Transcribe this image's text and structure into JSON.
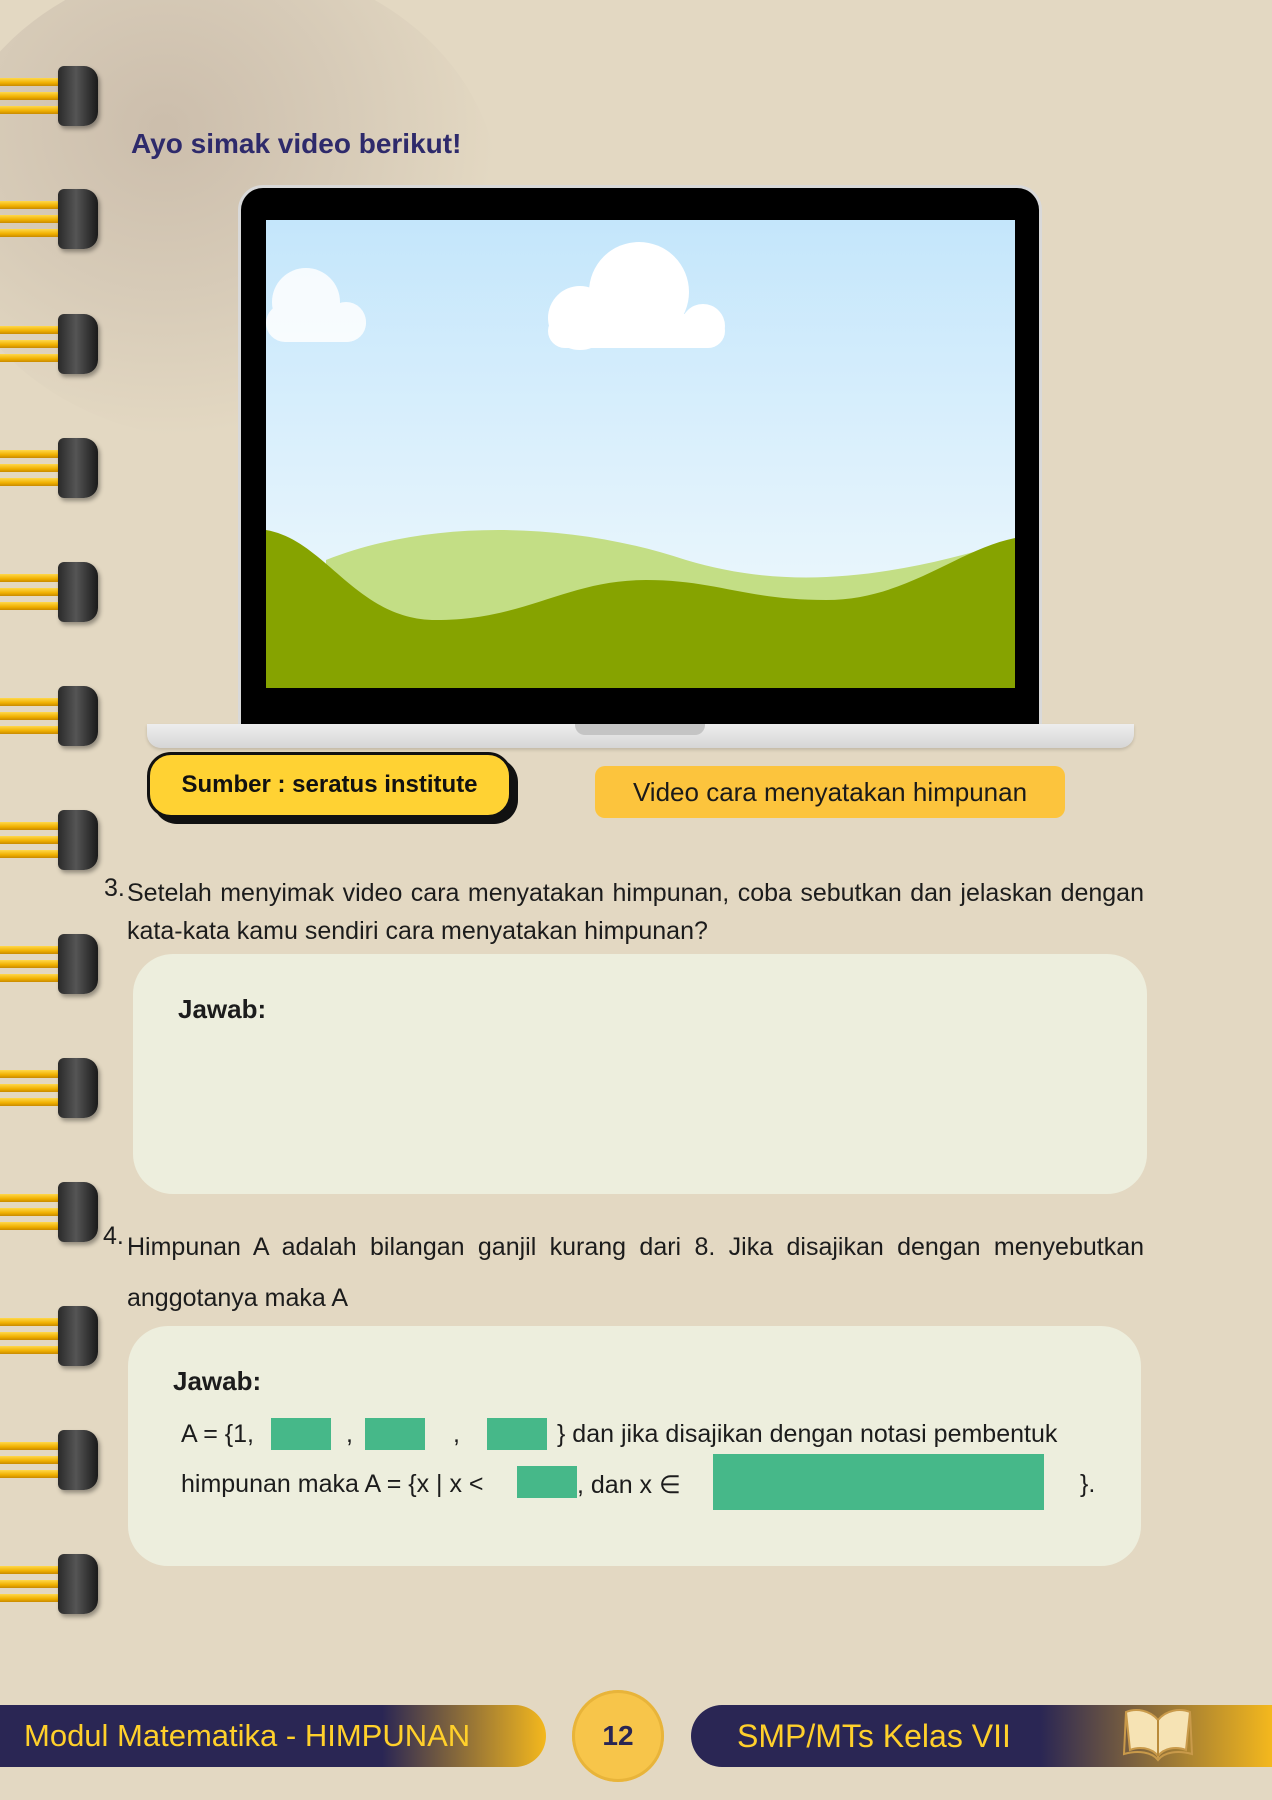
{
  "heading": "Ayo simak video berikut!",
  "video": {
    "source_label": "Sumber : seratus institute",
    "caption": "Video cara menyatakan himpunan"
  },
  "question3": {
    "number": "3.",
    "text": "Setelah menyimak video cara menyatakan himpunan, coba sebutkan dan jelaskan dengan kata-kata kamu sendiri cara menyatakan himpunan?",
    "answer_label": "Jawab:"
  },
  "question4": {
    "number": "4.",
    "text": "Himpunan A adalah bilangan ganjil kurang dari 8. Jika disajikan dengan menyebutkan anggotanya maka A",
    "answer_label": "Jawab:",
    "line1_start": "A = {1,",
    "comma1": ",",
    "comma2": ",",
    "line1_end": "} dan jika disajikan dengan notasi pembentuk",
    "line2_start": "himpunan maka A = {x | x <",
    "line2_mid": ", dan x ∈",
    "line2_end": "}."
  },
  "footer": {
    "left_title": "Modul Matematika - HIMPUNAN",
    "page_number": "12",
    "right_title": "SMP/MTs Kelas VII",
    "book_icon": "open-book-icon"
  }
}
